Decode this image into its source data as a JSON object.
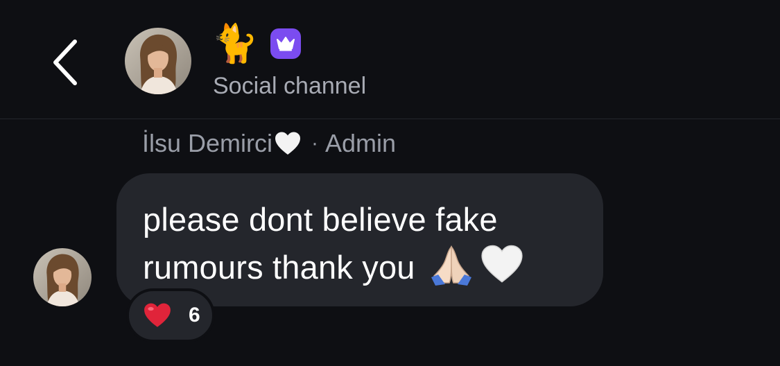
{
  "header": {
    "title_emoji": "🐈",
    "subtitle": "Social channel",
    "back_icon": "chevron-left-icon",
    "badge_icon": "crown-icon",
    "badge_color": "#7b4cf0"
  },
  "message": {
    "sender_name": "İlsu Demirci",
    "sender_heart_icon": "white-heart-icon",
    "separator": "·",
    "role": "Admin",
    "text": "please dont believe fake rumours thank you",
    "trailing_icons": [
      "folded-hands-icon",
      "white-heart-icon"
    ],
    "reaction": {
      "icon": "red-heart-icon",
      "count": "6"
    }
  },
  "colors": {
    "background": "#0e0f13",
    "bubble": "#24262c",
    "muted_text": "#9a9ea8",
    "reaction_heart": "#e0243a"
  }
}
